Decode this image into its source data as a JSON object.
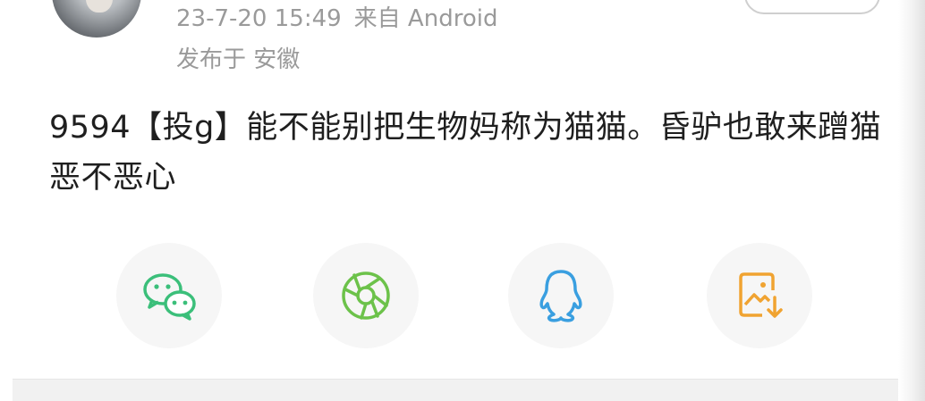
{
  "post": {
    "timestamp": "23-7-20 15:49",
    "source": "来自 Android",
    "location": "发布于 安徽",
    "text": "9594【投g】能不能别把生物妈称为猫猫。昏驴也敢来蹭猫恶不恶心"
  },
  "share": {
    "items": [
      {
        "icon": "wechat-icon",
        "color": "#3bbf7a"
      },
      {
        "icon": "moments-icon",
        "color": "#6cc24a"
      },
      {
        "icon": "qq-icon",
        "color": "#3a9fe0"
      },
      {
        "icon": "save-image-icon",
        "color": "#f0a331"
      }
    ]
  }
}
